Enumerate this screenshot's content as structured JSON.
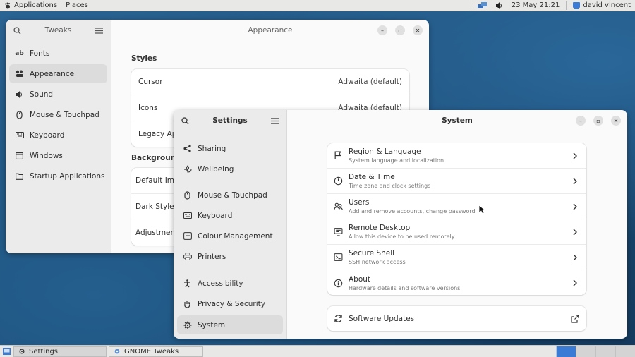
{
  "top_panel": {
    "applications": "Applications",
    "places": "Places",
    "datetime": "23 May  21:21",
    "user": "david vincent"
  },
  "tweaks_window": {
    "sidebar_title": "Tweaks",
    "title": "Appearance",
    "sidebar": [
      {
        "label": "Fonts",
        "icon": "font-icon"
      },
      {
        "label": "Appearance",
        "icon": "appearance-icon",
        "active": true
      },
      {
        "label": "Sound",
        "icon": "speaker-icon"
      },
      {
        "label": "Mouse & Touchpad",
        "icon": "mouse-icon"
      },
      {
        "label": "Keyboard",
        "icon": "keyboard-icon"
      },
      {
        "label": "Windows",
        "icon": "window-icon"
      },
      {
        "label": "Startup Applications",
        "icon": "folder-icon"
      }
    ],
    "styles_title": "Styles",
    "styles": [
      {
        "label": "Cursor",
        "value": "Adwaita (default)"
      },
      {
        "label": "Icons",
        "value": "Adwaita (default)"
      },
      {
        "label": "Legacy Appl",
        "value": ""
      }
    ],
    "background_title": "Background",
    "background": [
      {
        "label": "Default Imag"
      },
      {
        "label": "Dark Style In"
      },
      {
        "label": "Adjustment"
      }
    ]
  },
  "settings_window": {
    "sidebar_title": "Settings",
    "title": "System",
    "sidebar": [
      {
        "label": "Sharing",
        "icon": "share-icon"
      },
      {
        "label": "Wellbeing",
        "icon": "wellbeing-icon"
      },
      {
        "label": "Mouse & Touchpad",
        "icon": "mouse-icon"
      },
      {
        "label": "Keyboard",
        "icon": "keyboard-icon"
      },
      {
        "label": "Colour Management",
        "icon": "color-icon"
      },
      {
        "label": "Printers",
        "icon": "printer-icon"
      },
      {
        "label": "Accessibility",
        "icon": "accessibility-icon"
      },
      {
        "label": "Privacy & Security",
        "icon": "hand-icon"
      },
      {
        "label": "System",
        "icon": "gear-icon",
        "active": true
      }
    ],
    "rows": [
      {
        "title": "Region & Language",
        "subtitle": "System language and localization",
        "icon": "flag-icon"
      },
      {
        "title": "Date & Time",
        "subtitle": "Time zone and clock settings",
        "icon": "clock-icon"
      },
      {
        "title": "Users",
        "subtitle": "Add and remove accounts, change password",
        "icon": "users-icon"
      },
      {
        "title": "Remote Desktop",
        "subtitle": "Allow this device to be used remotely",
        "icon": "remote-icon"
      },
      {
        "title": "Secure Shell",
        "subtitle": "SSH network access",
        "icon": "terminal-icon"
      },
      {
        "title": "About",
        "subtitle": "Hardware details and software versions",
        "icon": "info-icon"
      }
    ],
    "software_updates": "Software Updates"
  },
  "bottom_panel": {
    "tasks": [
      {
        "label": "Settings",
        "active": true
      },
      {
        "label": "GNOME Tweaks",
        "active": false
      }
    ]
  }
}
